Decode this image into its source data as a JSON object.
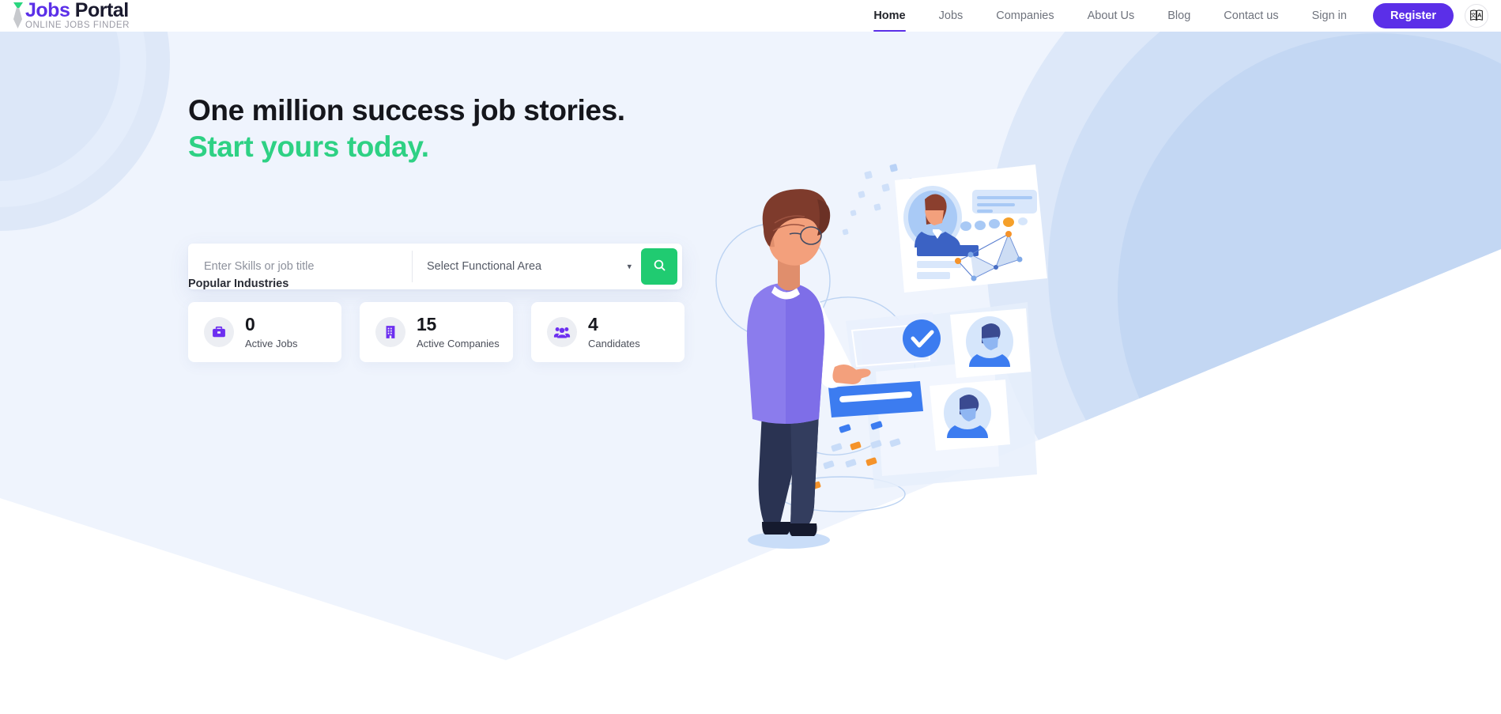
{
  "header": {
    "logo": {
      "title_part1": "Jobs",
      "title_part2": " Portal",
      "subtitle": "ONLINE JOBS FINDER",
      "tie_icon": "necktie-icon",
      "accent_green": "#2ad67f",
      "accent_purple": "#5b2fe8"
    },
    "nav": [
      {
        "label": "Home",
        "active": true
      },
      {
        "label": "Jobs",
        "active": false
      },
      {
        "label": "Companies",
        "active": false
      },
      {
        "label": "About Us",
        "active": false
      },
      {
        "label": "Blog",
        "active": false
      },
      {
        "label": "Contact us",
        "active": false
      },
      {
        "label": "Sign in",
        "active": false
      }
    ],
    "register_label": "Register",
    "translate_icon": "translate-icon",
    "translate_glyph_cjk": "文",
    "translate_glyph_latin": "A"
  },
  "hero": {
    "headline_line1": "One million success job stories.",
    "headline_line2": "Start yours today.",
    "headline_color_1": "#15161c",
    "headline_color_2": "#2ed184",
    "background_color": "#eff4fd"
  },
  "search": {
    "input_value": "",
    "input_placeholder": "Enter Skills or job title",
    "select_value": "Select Functional Area",
    "select_options": [
      "Select Functional Area"
    ],
    "chevron_icon": "chevron-down-icon",
    "button_icon": "search-icon",
    "button_color": "#20cb71"
  },
  "popular": {
    "label": "Popular Industries"
  },
  "stats": [
    {
      "value": "0",
      "label": "Active Jobs",
      "icon": "briefcase-icon"
    },
    {
      "value": "15",
      "label": "Active Companies",
      "icon": "building-icon"
    },
    {
      "value": "4",
      "label": "Candidates",
      "icon": "users-icon"
    }
  ],
  "illustration": {
    "name": "man-reviewing-candidate-profiles-illustration",
    "alt": "Man in purple sweater viewing floating candidate profile cards"
  }
}
